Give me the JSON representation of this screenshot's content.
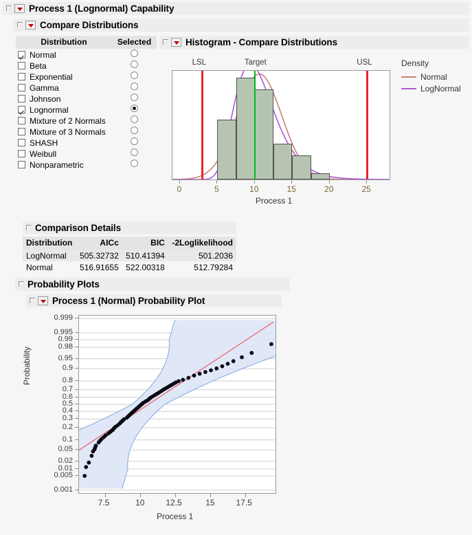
{
  "window": {
    "title": "Process 1 (Lognormal) Capability"
  },
  "compare_distributions": {
    "title": "Compare Distributions",
    "columns": {
      "distribution": "Distribution",
      "selected": "Selected"
    },
    "rows": [
      {
        "label": "Normal",
        "checked": true,
        "selected": false
      },
      {
        "label": "Beta",
        "checked": false,
        "selected": false
      },
      {
        "label": "Exponential",
        "checked": false,
        "selected": false
      },
      {
        "label": "Gamma",
        "checked": false,
        "selected": false
      },
      {
        "label": "Johnson",
        "checked": false,
        "selected": false
      },
      {
        "label": "Lognormal",
        "checked": true,
        "selected": true
      },
      {
        "label": "Mixture of 2 Normals",
        "checked": false,
        "selected": false
      },
      {
        "label": "Mixture of 3 Normals",
        "checked": false,
        "selected": false
      },
      {
        "label": "SHASH",
        "checked": false,
        "selected": false
      },
      {
        "label": "Weibull",
        "checked": false,
        "selected": false
      },
      {
        "label": "Nonparametric",
        "checked": false,
        "selected": false
      }
    ]
  },
  "histogram": {
    "title": "Histogram - Compare Distributions",
    "legend_title": "Density",
    "legend": [
      {
        "name": "Normal",
        "color": "#cb7f78"
      },
      {
        "name": "LogNormal",
        "color": "#a95ad8"
      }
    ],
    "limits": [
      {
        "name": "LSL",
        "value": 3,
        "color": "#e8232a"
      },
      {
        "name": "Target",
        "value": 10,
        "color": "#00b81f"
      },
      {
        "name": "USL",
        "value": 25,
        "color": "#e8232a"
      }
    ],
    "colors": {
      "bar_fill": "#b6c5b2",
      "bar_border": "#4f4f4f"
    }
  },
  "chart_data": [
    {
      "type": "bar",
      "title": "Histogram - Compare Distributions",
      "xlabel": "Process 1",
      "ylabel": "Density",
      "xlim": [
        -1,
        28
      ],
      "xticks": [
        0,
        5,
        10,
        15,
        20,
        25
      ],
      "bins": [
        {
          "start": 5.0,
          "end": 7.5,
          "count": 10
        },
        {
          "start": 7.5,
          "end": 10.0,
          "count": 17
        },
        {
          "start": 10.0,
          "end": 12.5,
          "count": 15
        },
        {
          "start": 12.5,
          "end": 15.0,
          "count": 6
        },
        {
          "start": 15.0,
          "end": 17.5,
          "count": 4
        },
        {
          "start": 17.5,
          "end": 20.0,
          "count": 1
        }
      ],
      "series": [
        {
          "name": "Normal",
          "color": "#cb7f78",
          "mean": 10.6,
          "sd": 3.0
        },
        {
          "name": "LogNormal",
          "color": "#a95ad8",
          "mu": 2.32,
          "sigma": 0.28
        }
      ],
      "reference_lines": [
        {
          "label": "LSL",
          "x": 3,
          "color": "#e8232a"
        },
        {
          "label": "Target",
          "x": 10,
          "color": "#00b81f"
        },
        {
          "label": "USL",
          "x": 25,
          "color": "#e8232a"
        }
      ]
    },
    {
      "type": "scatter",
      "title": "Process 1 (Normal) Probability Plot",
      "xlabel": "Process 1",
      "ylabel": "Probability",
      "xlim": [
        5.6,
        19.6
      ],
      "xticks": [
        7.5,
        10,
        12.5,
        15,
        17.5
      ],
      "yticks": [
        0.001,
        0.005,
        0.01,
        0.02,
        0.05,
        0.1,
        0.2,
        0.3,
        0.4,
        0.5,
        0.6,
        0.7,
        0.8,
        0.9,
        0.95,
        0.98,
        0.99,
        0.995,
        0.999
      ],
      "y_scale": "normal-probability",
      "fit_line": {
        "color": "#e8686e",
        "intercept_x_at_p50": 10.55,
        "slope_sd": 3.0
      },
      "confidence_band": {
        "fill": "#dde6f7",
        "stroke": "#7fa8dd",
        "level": 0.95
      },
      "points": [
        [
          6.0,
          0.005
        ],
        [
          6.1,
          0.012
        ],
        [
          6.3,
          0.018
        ],
        [
          6.5,
          0.032
        ],
        [
          6.6,
          0.045
        ],
        [
          6.7,
          0.052
        ],
        [
          6.75,
          0.06
        ],
        [
          6.8,
          0.068
        ],
        [
          7.0,
          0.085
        ],
        [
          7.1,
          0.095
        ],
        [
          7.2,
          0.105
        ],
        [
          7.35,
          0.118
        ],
        [
          7.5,
          0.132
        ],
        [
          7.7,
          0.148
        ],
        [
          7.85,
          0.162
        ],
        [
          8.0,
          0.178
        ],
        [
          8.1,
          0.195
        ],
        [
          8.2,
          0.21
        ],
        [
          8.35,
          0.225
        ],
        [
          8.5,
          0.245
        ],
        [
          8.6,
          0.262
        ],
        [
          8.7,
          0.278
        ],
        [
          8.8,
          0.295
        ],
        [
          9.0,
          0.315
        ],
        [
          9.1,
          0.332
        ],
        [
          9.2,
          0.35
        ],
        [
          9.3,
          0.368
        ],
        [
          9.4,
          0.385
        ],
        [
          9.5,
          0.402
        ],
        [
          9.6,
          0.42
        ],
        [
          9.7,
          0.438
        ],
        [
          9.8,
          0.455
        ],
        [
          9.9,
          0.472
        ],
        [
          10.0,
          0.49
        ],
        [
          10.1,
          0.508
        ],
        [
          10.2,
          0.525
        ],
        [
          10.35,
          0.542
        ],
        [
          10.5,
          0.56
        ],
        [
          10.6,
          0.578
        ],
        [
          10.7,
          0.595
        ],
        [
          10.85,
          0.612
        ],
        [
          11.0,
          0.63
        ],
        [
          11.15,
          0.648
        ],
        [
          11.3,
          0.665
        ],
        [
          11.45,
          0.682
        ],
        [
          11.6,
          0.7
        ],
        [
          11.75,
          0.715
        ],
        [
          11.9,
          0.73
        ],
        [
          12.05,
          0.745
        ],
        [
          12.2,
          0.758
        ],
        [
          12.35,
          0.772
        ],
        [
          12.5,
          0.785
        ],
        [
          12.7,
          0.798
        ],
        [
          13.0,
          0.812
        ],
        [
          13.4,
          0.83
        ],
        [
          13.8,
          0.85
        ],
        [
          14.2,
          0.865
        ],
        [
          14.6,
          0.878
        ],
        [
          15.0,
          0.89
        ],
        [
          15.4,
          0.902
        ],
        [
          15.8,
          0.915
        ],
        [
          16.2,
          0.928
        ],
        [
          16.6,
          0.94
        ],
        [
          17.2,
          0.955
        ],
        [
          17.9,
          0.968
        ],
        [
          19.3,
          0.985
        ]
      ]
    }
  ],
  "comparison_details": {
    "title": "Comparison Details",
    "columns": [
      "Distribution",
      "AICc",
      "BIC",
      "-2Loglikelihood"
    ],
    "rows": [
      [
        "LogNormal",
        "505.32732",
        "510.41394",
        "501.2036"
      ],
      [
        "Normal",
        "516.91655",
        "522.00318",
        "512.79284"
      ]
    ]
  },
  "probability_plots": {
    "title": "Probability Plots",
    "subtitle": "Process 1 (Normal) Probability Plot"
  }
}
